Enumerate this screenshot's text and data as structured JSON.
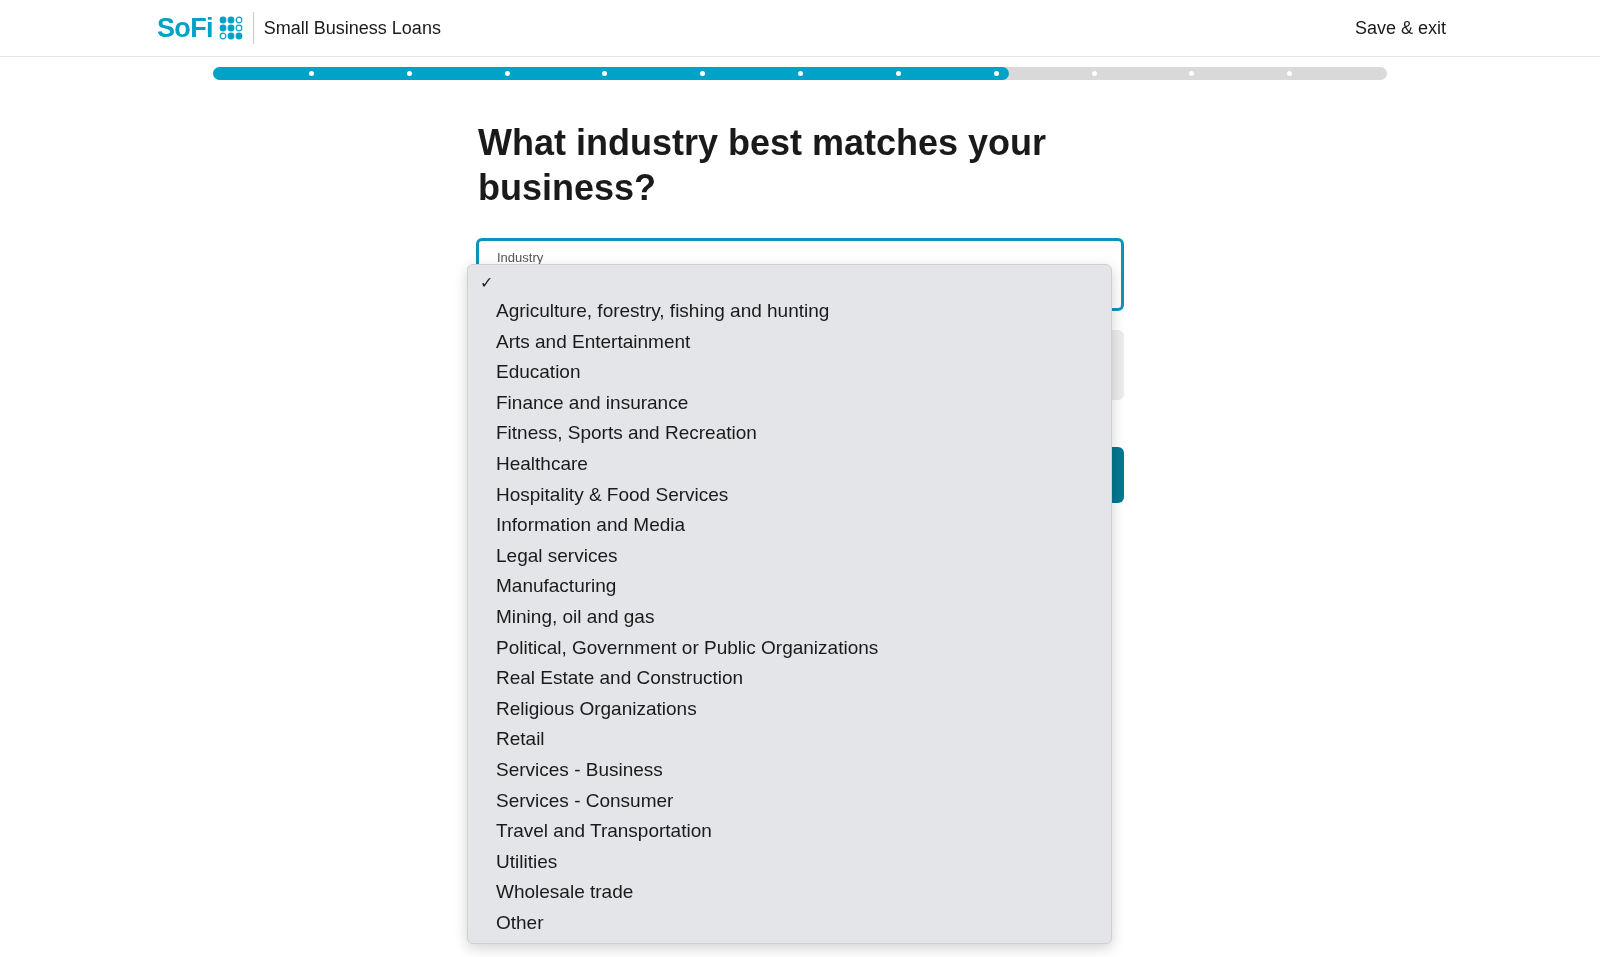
{
  "header": {
    "brand": "SoFi",
    "product": "Small Business Loans",
    "exit_link": "Save & exit"
  },
  "progress": {
    "level": 0.678
  },
  "question": "What industry best matches your business?",
  "field": {
    "label": "Industry",
    "focused": true
  },
  "menu": {
    "blank_option": {
      "mark": "✓",
      "selected": true
    },
    "options": [
      {
        "label": "Agriculture, forestry, fishing and hunting",
        "selected": false
      },
      {
        "label": "Arts and Entertainment",
        "selected": false
      },
      {
        "label": "Education",
        "selected": false
      },
      {
        "label": "Finance and insurance",
        "selected": false
      },
      {
        "label": "Fitness, Sports and Recreation",
        "selected": false
      },
      {
        "label": "Healthcare",
        "selected": false
      },
      {
        "label": "Hospitality & Food Services",
        "selected": false
      },
      {
        "label": "Information and Media",
        "selected": false
      },
      {
        "label": "Legal services",
        "selected": false
      },
      {
        "label": "Manufacturing",
        "selected": false
      },
      {
        "label": "Mining, oil and gas",
        "selected": false
      },
      {
        "label": "Political, Government or Public Organizations",
        "selected": false
      },
      {
        "label": "Real Estate and Construction",
        "selected": false
      },
      {
        "label": "Religious Organizations",
        "selected": false
      },
      {
        "label": "Retail",
        "selected": false
      },
      {
        "label": "Services - Business",
        "selected": false
      },
      {
        "label": "Services - Consumer",
        "selected": false
      },
      {
        "label": "Travel and Transportation",
        "selected": false
      },
      {
        "label": "Utilities",
        "selected": false
      },
      {
        "label": "Wholesale trade",
        "selected": false
      },
      {
        "label": "Other",
        "selected": false
      }
    ]
  }
}
